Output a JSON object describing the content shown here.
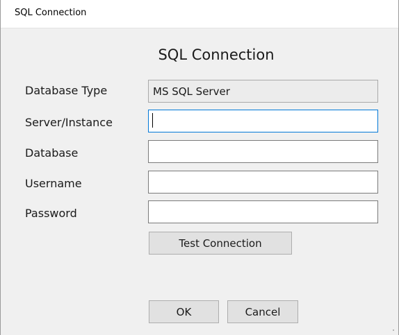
{
  "window": {
    "title": "SQL Connection"
  },
  "form": {
    "heading": "SQL Connection",
    "database_type": {
      "label": "Database Type",
      "value": "MS SQL Server"
    },
    "server_instance": {
      "label": "Server/Instance",
      "value": ""
    },
    "database": {
      "label": "Database",
      "value": ""
    },
    "username": {
      "label": "Username",
      "value": ""
    },
    "password": {
      "label": "Password",
      "value": ""
    }
  },
  "buttons": {
    "test_connection": "Test Connection",
    "ok": "OK",
    "cancel": "Cancel"
  },
  "colors": {
    "focus_border": "#0078d7",
    "button_face": "#e1e1e1",
    "window_background": "#f0f0f0"
  }
}
